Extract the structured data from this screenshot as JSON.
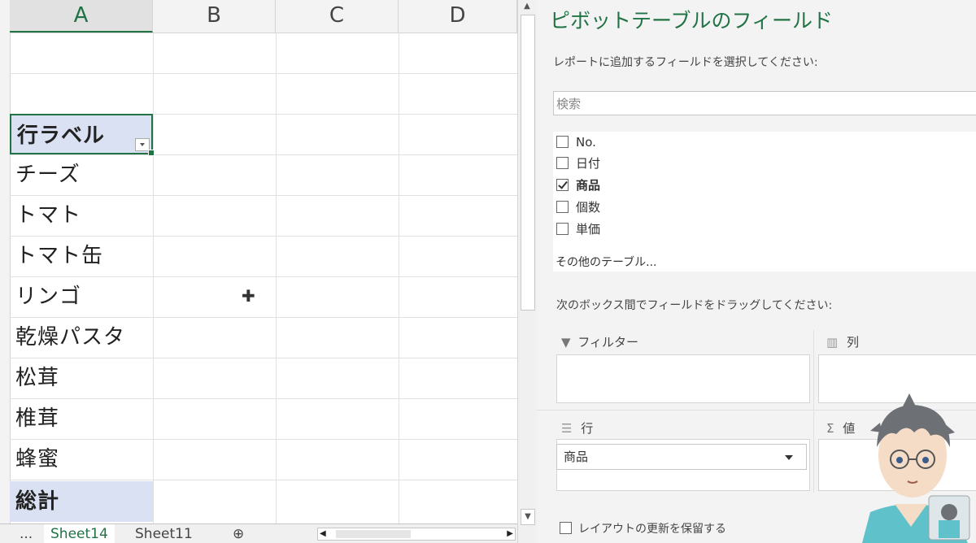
{
  "sheet": {
    "columns": [
      "A",
      "B",
      "C",
      "D"
    ],
    "header_cell": "行ラベル",
    "rows": [
      "チーズ",
      "トマト",
      "トマト缶",
      "リンゴ",
      "乾燥パスタ",
      "松茸",
      "椎茸",
      "蜂蜜"
    ],
    "total": "総計",
    "tabs": [
      "...",
      "Sheet14",
      "Sheet11"
    ],
    "add_sheet": "⊕"
  },
  "pane": {
    "title": "ピボットテーブルのフィールド",
    "subtitle": "レポートに追加するフィールドを選択してください:",
    "search_placeholder": "検索",
    "fields": [
      {
        "label": "No.",
        "checked": false
      },
      {
        "label": "日付",
        "checked": false
      },
      {
        "label": "商品",
        "checked": true
      },
      {
        "label": "個数",
        "checked": false
      },
      {
        "label": "単価",
        "checked": false
      }
    ],
    "more_tables": "その他のテーブル...",
    "drag_hint": "次のボックス間でフィールドをドラッグしてください:",
    "areas": {
      "filter": "フィルター",
      "columns": "列",
      "rows": "行",
      "values": "値"
    },
    "row_field": "商品",
    "defer_update": "レイアウトの更新を保留する"
  },
  "colors": {
    "accent": "#217346",
    "header_fill": "#d9e1f2"
  }
}
